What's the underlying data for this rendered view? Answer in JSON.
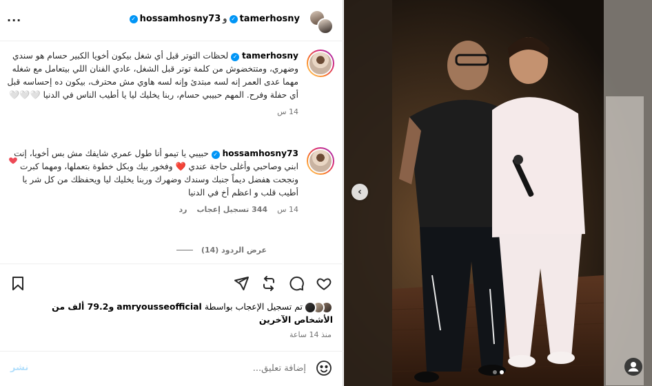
{
  "header": {
    "user1": "tamerhosny",
    "separator": "و",
    "user2": "hossamhosny73",
    "more_label": "···"
  },
  "comments": [
    {
      "username": "tamerhosny",
      "text": "لحظات التوتر قبل أي شغل بيكون أخويا الكبير حسام هو سندي وضهري، ومتتخضوش من كلمة توتر قبل الشغل، عادي الفنان اللي بيتعامل مع شغله مهما عدى العمر إنه لسه مبتدئ وإنه لسه هاوي مش محترف، بيكون ده إحساسه قبل أي حفلة وفرح. المهم حبيبي حسام، ربنا يخليك ليا يا أطيب الناس في الدنيا 🤍🤍🤍",
      "time": "14 س"
    },
    {
      "username": "hossamhosny73",
      "text": "حبيبي يا تيمو أنا طول عمري شايفك مش بس أخويا، إنت ابني وصاحبي وأغلى حاجة عندي ❤️ وفخور بيك وبكل خطوة بتعملها، ومهما كبرت ونجحت هفضل ديماً جنبك وسندك وضهرك وربنا يخليك ليا ويحفظك من كل شر يا أطيب قلب و اعظم أخ في الدنيا",
      "time": "14 س",
      "likes": "344 تسجيل إعجاب",
      "reply": "رد"
    }
  ],
  "replies_label": "عرض الردود (14)",
  "likes_line": {
    "prefix": "تم تسجيل الإعجاب بواسطة",
    "user": "amryousseofficial",
    "suffix_bold": "و79.2 ألف من",
    "suffix2": "الأشخاص الآخرين"
  },
  "post_time": "منذ 14 ساعة",
  "comment_input": {
    "placeholder": "إضافة تعليق..."
  },
  "post_button": "نشر",
  "icons": {
    "more": "more-horizontal-icon",
    "like": "heart-icon",
    "comment": "comment-icon",
    "share": "share-icon",
    "repost": "repost-icon",
    "save": "bookmark-icon",
    "emoji": "emoji-icon",
    "prev": "chevron-left-icon",
    "tagged": "person-icon"
  },
  "colors": {
    "verified": "#0095f6",
    "liked_heart": "#ed4956",
    "post_button": "#b2dffc"
  },
  "carousel": {
    "total": 2,
    "current": 2
  }
}
